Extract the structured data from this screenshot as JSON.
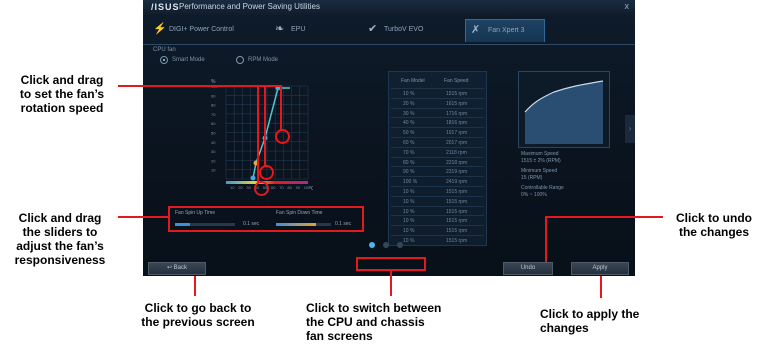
{
  "app": {
    "title": "Performance and Power Saving Utilities",
    "logo": "/ISUS",
    "close": "x",
    "tabs": [
      {
        "label": "DIGI+ Power Control",
        "icon": "lightning-icon"
      },
      {
        "label": "EPU",
        "icon": "leaf-icon"
      },
      {
        "label": "TurboV EVO",
        "icon": "checkmark-icon"
      },
      {
        "label": "Fan Xpert 3",
        "icon": "fan-icon"
      }
    ],
    "fan_section_label": "CPU fan",
    "modes": [
      "Smart Mode",
      "RPM Mode"
    ],
    "chart": {
      "y_axis_unit": "%",
      "x_axis_unit": "°C",
      "y_ticks": [
        "100",
        "90",
        "80",
        "70",
        "60",
        "50",
        "40",
        "30",
        "20",
        "10"
      ],
      "x_ticks": [
        "10",
        "20",
        "30",
        "40",
        "50",
        "60",
        "70",
        "80",
        "90",
        "100"
      ]
    },
    "table": {
      "headers": [
        "Fan Model",
        "Fan Speed"
      ],
      "rows": [
        [
          "10 %",
          "1515 rpm"
        ],
        [
          "20 %",
          "1615 rpm"
        ],
        [
          "30 %",
          "1716 rpm"
        ],
        [
          "40 %",
          "1816 rpm"
        ],
        [
          "50 %",
          "1917 rpm"
        ],
        [
          "60 %",
          "2017 rpm"
        ],
        [
          "70 %",
          "2118 rpm"
        ],
        [
          "80 %",
          "2218 rpm"
        ],
        [
          "90 %",
          "2319 rpm"
        ],
        [
          "100 %",
          "2419 rpm"
        ],
        [
          "10 %",
          "1515 rpm"
        ],
        [
          "10 %",
          "1515 rpm"
        ],
        [
          "10 %",
          "1515 rpm"
        ],
        [
          "10 %",
          "1515 rpm"
        ],
        [
          "10 %",
          "1515 rpm"
        ],
        [
          "10 %",
          "1515 rpm"
        ]
      ]
    },
    "info": {
      "max_speed_label": "Maximum Speed",
      "max_speed_value": "1515 ± 2% (RPM)",
      "min_speed_label": "Minimum Speed",
      "min_speed_value": "15 (RPM)",
      "range_label": "Controllable Range",
      "range_value": "0% ~ 100%"
    },
    "sliders": {
      "spin_up_label": "Fan Spin Up Time",
      "spin_up_value": "0.1 sec",
      "spin_down_label": "Fan Spin Down Time",
      "spin_down_value": "0.1 sec"
    },
    "buttons": {
      "back": "Back",
      "undo": "Undo",
      "apply": "Apply"
    }
  },
  "annotations": {
    "drag_fan": [
      "Click and drag",
      "to set the fan’s",
      "rotation speed"
    ],
    "drag_sliders": [
      "Click and drag",
      "the sliders to",
      "adjust the fan’s",
      "responsiveness"
    ],
    "undo": [
      "Click to undo",
      "the changes"
    ],
    "back": [
      "Click to go back to",
      "the previous screen"
    ],
    "switch": [
      "Click to switch between",
      "the CPU and chassis",
      "fan screens"
    ],
    "apply": [
      "Click to apply the",
      "changes"
    ]
  },
  "colors": {
    "accent": "#e4191e",
    "curve": "#4fc7c9",
    "background": "#0b1520"
  }
}
